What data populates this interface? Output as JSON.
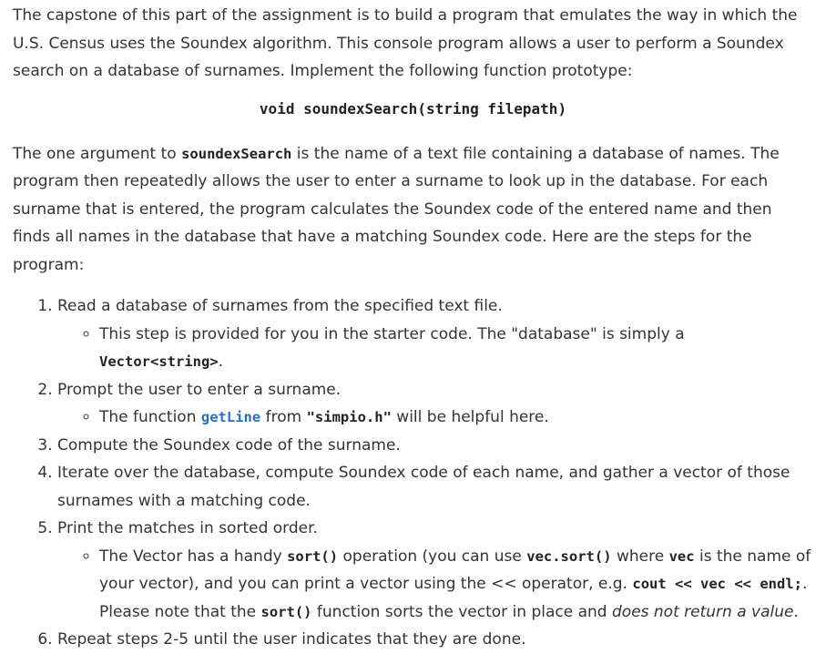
{
  "intro": {
    "text_before_prototype": "The capstone of this part of the assignment is to build a program that emulates the way in which the U.S. Census uses the Soundex algorithm. This console program allows a user to perform a Soundex search on a database of surnames. Implement the following function prototype:"
  },
  "prototype": "void soundexSearch(string filepath)",
  "description": {
    "part1": "The one argument to ",
    "code_function": "soundexSearch",
    "part2": " is the name of a text file containing a database of names. The program then repeatedly allows the user to enter a surname to look up in the database. For each surname that is entered, the program calculates the Soundex code of the entered name and then finds all names in the database that have a matching Soundex code. Here are the steps for the program:"
  },
  "steps": {
    "step1": {
      "text": "Read a database of surnames from the specified text file.",
      "sub_text": "This step is provided for you in the starter code. The \"database\" is simply a ",
      "sub_code": "Vector<string>",
      "sub_end": "."
    },
    "step2": {
      "text": "Prompt the user to enter a surname.",
      "sub_text1": "The function ",
      "sub_link": "getLine",
      "sub_text2": " from ",
      "sub_code": "\"simpio.h\"",
      "sub_text3": " will be helpful here."
    },
    "step3": {
      "text": "Compute the Soundex code of the surname."
    },
    "step4": {
      "text": "Iterate over the database, compute Soundex code of each name, and gather a vector of those surnames with a matching code."
    },
    "step5": {
      "text": "Print the matches in sorted order.",
      "sub_t1": "The Vector has a handy ",
      "sub_c1": "sort()",
      "sub_t2": " operation (you can use ",
      "sub_c2": "vec.sort()",
      "sub_t3": " where ",
      "sub_c3": "vec",
      "sub_t4": " is the name of your vector), and you can print a vector using the << operator, e.g. ",
      "sub_c4": "cout << vec << endl;",
      "sub_t5": ". Please note that the ",
      "sub_c5": "sort()",
      "sub_t6": " function sorts the vector in place and ",
      "sub_em": "does not return a value",
      "sub_t7": "."
    },
    "step6": {
      "text": "Repeat steps 2-5 until the user indicates that they are done."
    }
  }
}
